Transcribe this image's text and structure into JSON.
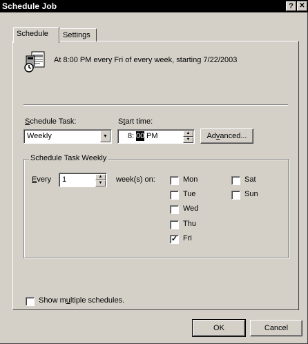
{
  "window": {
    "title": "Schedule Job",
    "help_btn": "?",
    "close_btn": "✕"
  },
  "tabs": [
    {
      "label": "Schedule",
      "active": true
    },
    {
      "label": "Settings",
      "active": false
    }
  ],
  "summary": {
    "icon": "scheduled-task-icon",
    "text": "At 8:00 PM every Fri of every week, starting 7/22/2003"
  },
  "schedule_task": {
    "label_pre": "",
    "label_u": "S",
    "label_post": "chedule Task:",
    "value": "Weekly"
  },
  "start_time": {
    "label_pre": "S",
    "label_u": "t",
    "label_post": "art time:",
    "hour": "8:",
    "minute": "00",
    "ampm": "PM"
  },
  "advanced_button": {
    "pre": "Ad",
    "u": "v",
    "post": "anced..."
  },
  "weekly_group": {
    "legend": "Schedule Task Weekly",
    "every_u": "E",
    "every_post": "very",
    "every_value": "1",
    "weeks_label": "week(s) on:",
    "days_left": [
      {
        "label": "Mon",
        "checked": false
      },
      {
        "label": "Tue",
        "checked": false
      },
      {
        "label": "Wed",
        "checked": false
      },
      {
        "label": "Thu",
        "checked": false
      },
      {
        "label": "Fri",
        "checked": true
      }
    ],
    "days_right": [
      {
        "label": "Sat",
        "checked": false
      },
      {
        "label": "Sun",
        "checked": false
      }
    ]
  },
  "multiple": {
    "pre": "Show m",
    "u": "u",
    "post": "ltiple schedules.",
    "checked": false
  },
  "buttons": {
    "ok": "OK",
    "cancel": "Cancel"
  },
  "colors": {
    "face": "#d4d0c8",
    "titlebar": "#000000",
    "field": "#ffffff",
    "selection": "#000000"
  }
}
